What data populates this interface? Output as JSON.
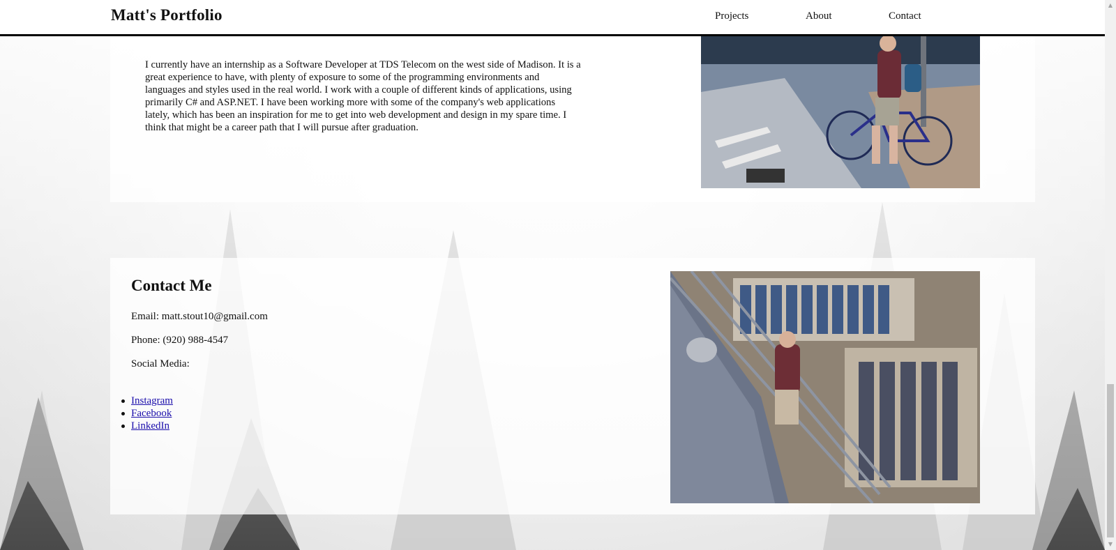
{
  "header": {
    "brand": "Matt's Portfolio",
    "nav": [
      "Projects",
      "About",
      "Contact"
    ]
  },
  "about": {
    "paragraph": "I currently have an internship as a Software Developer at TDS Telecom on the west side of Madison. It is a great experience to have, with plenty of exposure to some of the programming environments and languages and styles used in the real world. I work with a couple of different kinds of applications, using primarily C# and ASP.NET. I have been working more with some of the company's web applications lately, which has been an inspiration for me to get into web development and design in my spare time. I think that might be a career path that I will pursue after graduation."
  },
  "contact": {
    "title": "Contact Me",
    "email": "Email: matt.stout10@gmail.com",
    "phone": "Phone: (920) 988-4547",
    "social_label": "Social Media:",
    "social_links": [
      "Instagram",
      "Facebook",
      "LinkedIn"
    ]
  },
  "colors": {
    "link": "#1a0dab",
    "header_border": "#000000"
  }
}
